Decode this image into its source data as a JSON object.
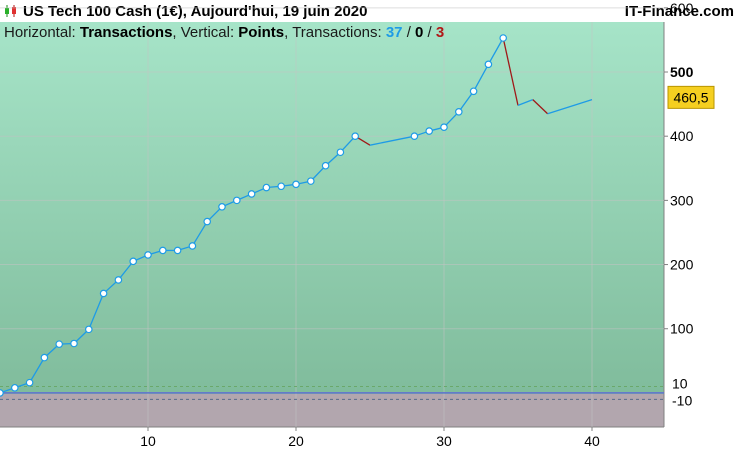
{
  "header": {
    "title": "US Tech 100 Cash (1€), Aujourd'hui, 19 juin 2020",
    "brand": "IT-Finance.com"
  },
  "legend": {
    "h_label": "Horizontal: ",
    "h_value": "Transactions",
    "v_label": ", Vertical: ",
    "v_value": "Points",
    "t_label": ", Transactions: ",
    "count_a": "37",
    "sep1": " / ",
    "count_b": "0",
    "sep2": " / ",
    "count_c": "3"
  },
  "colors": {
    "gain_line": "#1e9be6",
    "loss_line": "#a01818",
    "bg_top": "#a6e4c8",
    "bg_bottom": "#80bc9c",
    "lower_panel": "#b2a6ae",
    "last_price_badge": "#f5cf20"
  },
  "chart_data": {
    "type": "line",
    "x": [
      0,
      1,
      2,
      3,
      4,
      5,
      6,
      7,
      8,
      9,
      10,
      11,
      12,
      13,
      14,
      15,
      16,
      17,
      18,
      19,
      20,
      21,
      22,
      23,
      24,
      25,
      28,
      29,
      30,
      31,
      32,
      33,
      34,
      35,
      36,
      37,
      40
    ],
    "y": [
      0,
      8,
      16,
      55,
      76,
      77,
      99,
      155,
      176,
      205,
      215,
      222,
      222,
      229,
      267,
      290,
      300,
      310,
      320,
      322,
      325,
      330,
      354,
      375,
      400,
      386,
      400,
      408,
      414,
      438,
      470,
      512,
      553,
      448,
      457,
      435,
      457
    ],
    "markers": [
      true,
      true,
      true,
      true,
      true,
      true,
      true,
      true,
      true,
      true,
      true,
      true,
      true,
      true,
      true,
      true,
      true,
      true,
      true,
      true,
      true,
      true,
      true,
      true,
      true,
      false,
      true,
      true,
      true,
      true,
      true,
      true,
      true,
      false,
      false,
      false,
      false
    ],
    "xlim": [
      0,
      45
    ],
    "ylim": [
      -50,
      620
    ],
    "x_ticks": [
      "10",
      "20",
      "30",
      "40"
    ],
    "y_ticks": [
      "100",
      "200",
      "300",
      "400",
      "500",
      "600"
    ],
    "last_value": "460,5",
    "lower_levels": [
      "10",
      "-10"
    ],
    "grid": true
  }
}
